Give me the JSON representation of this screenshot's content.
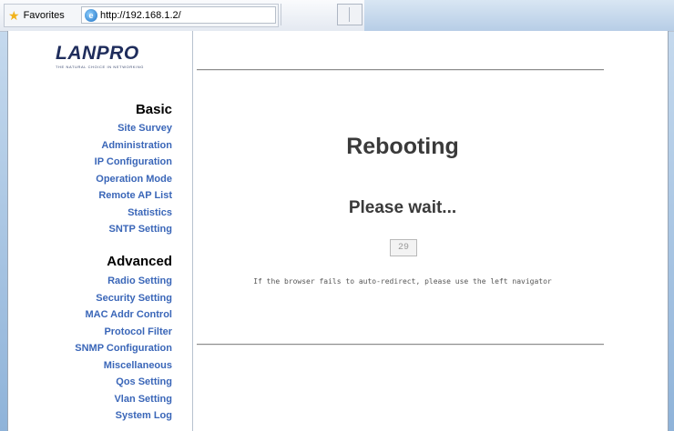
{
  "browser": {
    "favorites_label": "Favorites",
    "address": "http://192.168.1.2/"
  },
  "logo": {
    "name": "LANPRO",
    "tagline": "THE NATURAL CHOICE IN NETWORKING"
  },
  "nav": {
    "basic_heading": "Basic",
    "basic_items": [
      "Site Survey",
      "Administration",
      "IP Configuration",
      "Operation Mode",
      "Remote AP List",
      "Statistics",
      "SNTP Setting"
    ],
    "advanced_heading": "Advanced",
    "advanced_items": [
      "Radio Setting",
      "Security Setting",
      "MAC Addr Control",
      "Protocol Filter",
      "SNMP Configuration",
      "Miscellaneous",
      "Qos Setting",
      "Vlan Setting",
      "System Log"
    ]
  },
  "main": {
    "title": "Rebooting",
    "wait_text": "Please wait...",
    "countdown": "29",
    "hint": "If the browser fails to auto-redirect, please use the left navigator"
  },
  "colors": {
    "nav_link": "#3a66b8",
    "logo": "#1f2d5c",
    "frame": "#8fb3d9"
  }
}
